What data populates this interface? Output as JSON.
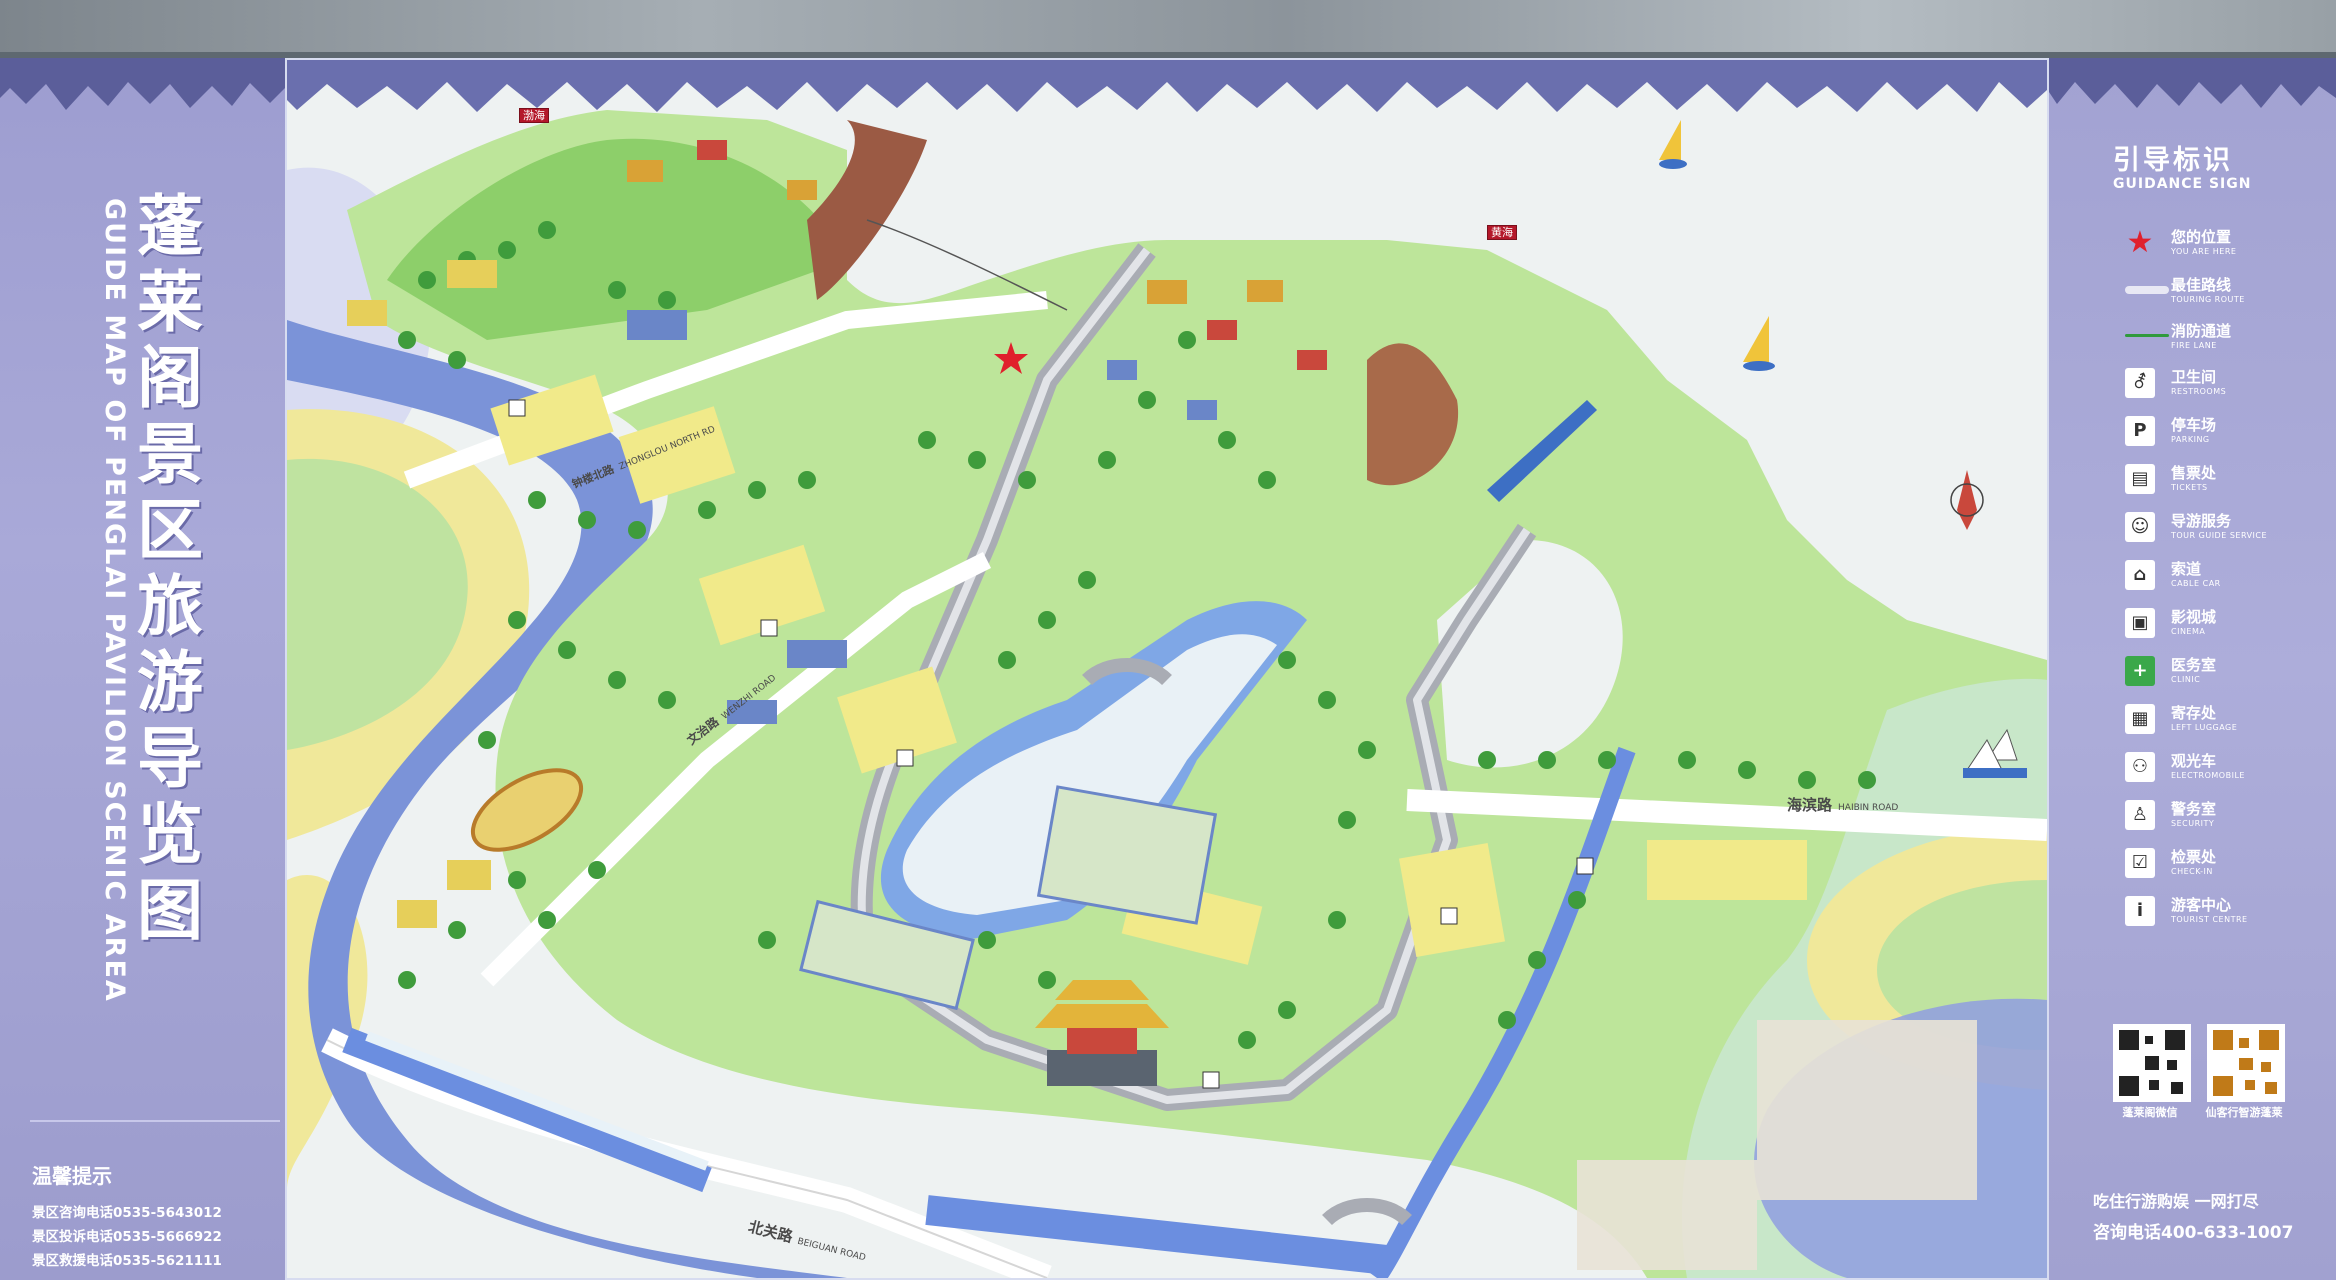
{
  "title_cn": "蓬莱阁景区旅游导览图",
  "title_en": "GUIDE MAP OF PENGLAI PAVILION SCENIC AREA",
  "tips": {
    "heading": "温馨提示",
    "lines": [
      "景区咨询电话0535-5643012",
      "景区投诉电话0535-5666922",
      "景区救援电话0535-5621111"
    ]
  },
  "legend": {
    "title": "引导标识",
    "subtitle": "GUIDANCE SIGN",
    "items": [
      {
        "cn": "您的位置",
        "en": "YOU ARE HERE",
        "icon": "star-icon"
      },
      {
        "cn": "最佳路线",
        "en": "TOURING ROUTE",
        "icon": "route-line-icon"
      },
      {
        "cn": "消防通道",
        "en": "FIRE LANE",
        "icon": "fire-lane-line-icon"
      },
      {
        "cn": "卫生间",
        "en": "RESTROOMS",
        "icon": "restroom-icon"
      },
      {
        "cn": "停车场",
        "en": "PARKING",
        "icon": "parking-icon"
      },
      {
        "cn": "售票处",
        "en": "TICKETS",
        "icon": "ticket-icon"
      },
      {
        "cn": "导游服务",
        "en": "TOUR GUIDE SERVICE",
        "icon": "tour-guide-icon"
      },
      {
        "cn": "索道",
        "en": "CABLE CAR",
        "icon": "cable-car-icon"
      },
      {
        "cn": "影视城",
        "en": "CINEMA",
        "icon": "cinema-icon"
      },
      {
        "cn": "医务室",
        "en": "CLINIC",
        "icon": "clinic-icon"
      },
      {
        "cn": "寄存处",
        "en": "LEFT LUGGAGE",
        "icon": "luggage-icon"
      },
      {
        "cn": "观光车",
        "en": "ELECTROMOBILE",
        "icon": "electromobile-icon"
      },
      {
        "cn": "警务室",
        "en": "SECURITY",
        "icon": "security-icon"
      },
      {
        "cn": "检票处",
        "en": "CHECK-IN",
        "icon": "check-in-icon"
      },
      {
        "cn": "游客中心",
        "en": "TOURIST CENTRE",
        "icon": "info-icon"
      }
    ]
  },
  "qr_captions": [
    "蓬莱阁微信",
    "仙客行智游蓬莱"
  ],
  "slogan": "吃住行游购娱 一网打尽",
  "hotline": "咨询电话400-633-1007",
  "roads": {
    "beiguan": {
      "cn": "北关路",
      "en": "BEIGUAN ROAD"
    },
    "haibin": {
      "cn": "海滨路",
      "en": "HAIBIN ROAD"
    },
    "zhonglu": {
      "cn": "钟楼北路",
      "en": "ZHONGLOU NORTH RD"
    },
    "wenzhi": {
      "cn": "文治路",
      "en": "WENZHI ROAD"
    }
  },
  "sea_labels": {
    "north": "黄海",
    "west": "渤海"
  },
  "colors": {
    "sea": "#eef2f2",
    "land": "#b8e08e",
    "water": "#6f8fd8",
    "wall": "#b9bcc2",
    "label": "#b4182a",
    "panel": "#a6a6d6"
  }
}
